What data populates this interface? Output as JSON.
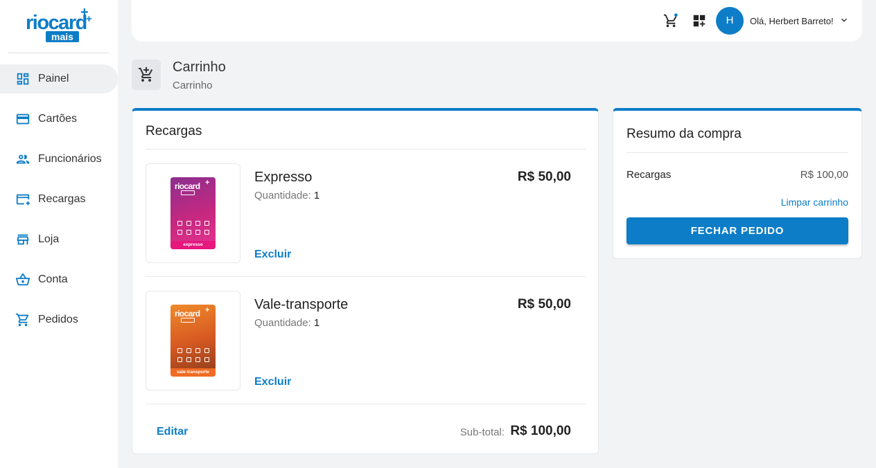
{
  "logo": {
    "line1": "riocard",
    "line2": "mais",
    "plus": "+"
  },
  "sidebar": {
    "items": [
      {
        "label": "Painel",
        "icon": "dashboard-icon"
      },
      {
        "label": "Cartões",
        "icon": "credit-card-icon"
      },
      {
        "label": "Funcionários",
        "icon": "people-icon"
      },
      {
        "label": "Recargas",
        "icon": "card-add-icon"
      },
      {
        "label": "Loja",
        "icon": "store-icon"
      },
      {
        "label": "Conta",
        "icon": "basket-icon"
      },
      {
        "label": "Pedidos",
        "icon": "cart-icon"
      }
    ]
  },
  "header": {
    "avatar_initial": "H",
    "greeting": "Olá, Herbert Barreto!"
  },
  "page": {
    "title": "Carrinho",
    "breadcrumb": "Carrinho"
  },
  "cart": {
    "title": "Recargas",
    "items": [
      {
        "name": "Expresso",
        "qty_label": "Quantidade:",
        "qty": "1",
        "price": "R$ 50,00",
        "remove_label": "Excluir",
        "card_brand": "riocard",
        "card_strip": "expresso"
      },
      {
        "name": "Vale-transporte",
        "qty_label": "Quantidade:",
        "qty": "1",
        "price": "R$ 50,00",
        "remove_label": "Excluir",
        "card_brand": "riocard",
        "card_strip": "vale-transporte"
      }
    ],
    "edit_label": "Editar",
    "subtotal_label": "Sub-total:",
    "subtotal_value": "R$ 100,00"
  },
  "summary": {
    "title": "Resumo da compra",
    "row_label": "Recargas",
    "row_value": "R$ 100,00",
    "clear_label": "Limpar carrinho",
    "checkout_label": "FECHAR PEDIDO"
  },
  "colors": {
    "accent": "#0d7dc7",
    "background": "#f2f3f5",
    "card_express": "#c6287f",
    "card_vt": "#e8622a"
  }
}
